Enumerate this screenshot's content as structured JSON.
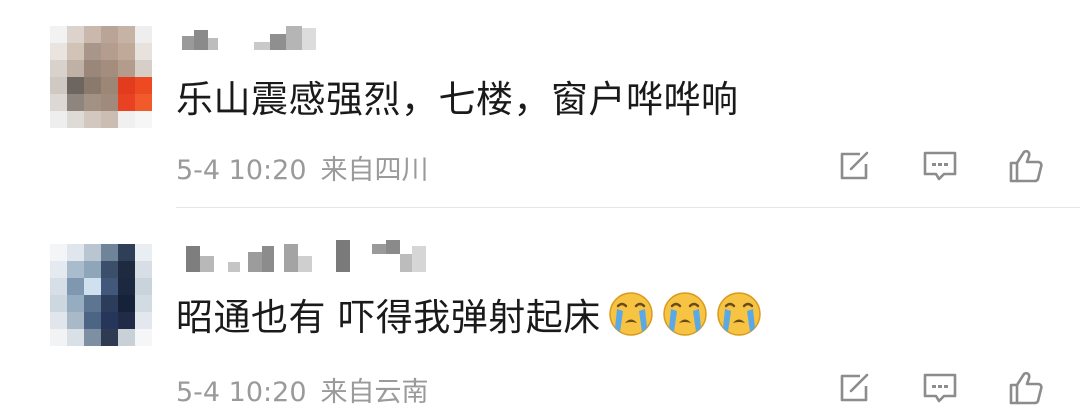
{
  "comments": [
    {
      "text": "乐山震感强烈，七楼，窗户哗哗响",
      "time": "5-4 10:20",
      "location": "来自四川",
      "emojis": []
    },
    {
      "text": "昭通也有 吓得我弹射起床",
      "time": "5-4 10:20",
      "location": "来自云南",
      "emojis": [
        "crying-face-emoji",
        "crying-face-emoji",
        "crying-face-emoji"
      ]
    }
  ],
  "colors": {
    "text": "#1a1a1a",
    "meta": "#9a9a9a",
    "icon": "#8c8c8c",
    "divider": "#e6e6e6",
    "emoji_face": "#f6c342",
    "emoji_tear": "#5aa9e6"
  },
  "icons": [
    "share-icon",
    "comment-icon",
    "like-icon"
  ]
}
